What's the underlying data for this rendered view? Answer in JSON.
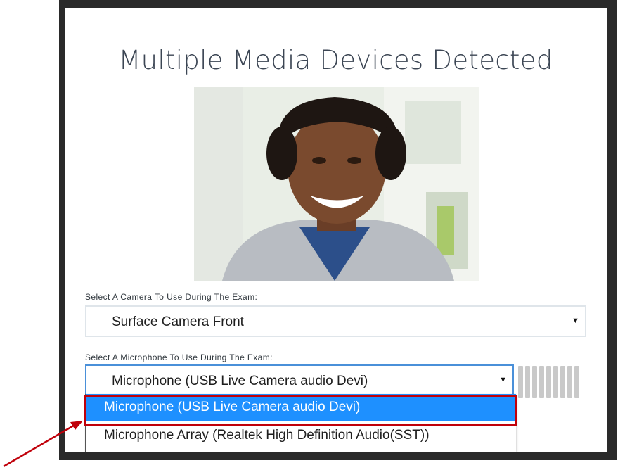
{
  "dialog": {
    "title": "Multiple Media Devices Detected"
  },
  "camera": {
    "label": "Select A Camera To Use During The Exam:",
    "selected": "Surface Camera Front"
  },
  "microphone": {
    "label": "Select A Microphone To Use During The Exam:",
    "selected": "Microphone (USB Live Camera audio Devi)",
    "options": [
      "Microphone (USB Live Camera audio Devi)",
      "Microphone Array (Realtek High Definition Audio(SST))"
    ],
    "highlighted_option_index": 0,
    "level_bars": 9
  },
  "colors": {
    "highlight_option": "#1e90ff",
    "callout": "#c0000a",
    "focus_border": "#4a90d9"
  }
}
